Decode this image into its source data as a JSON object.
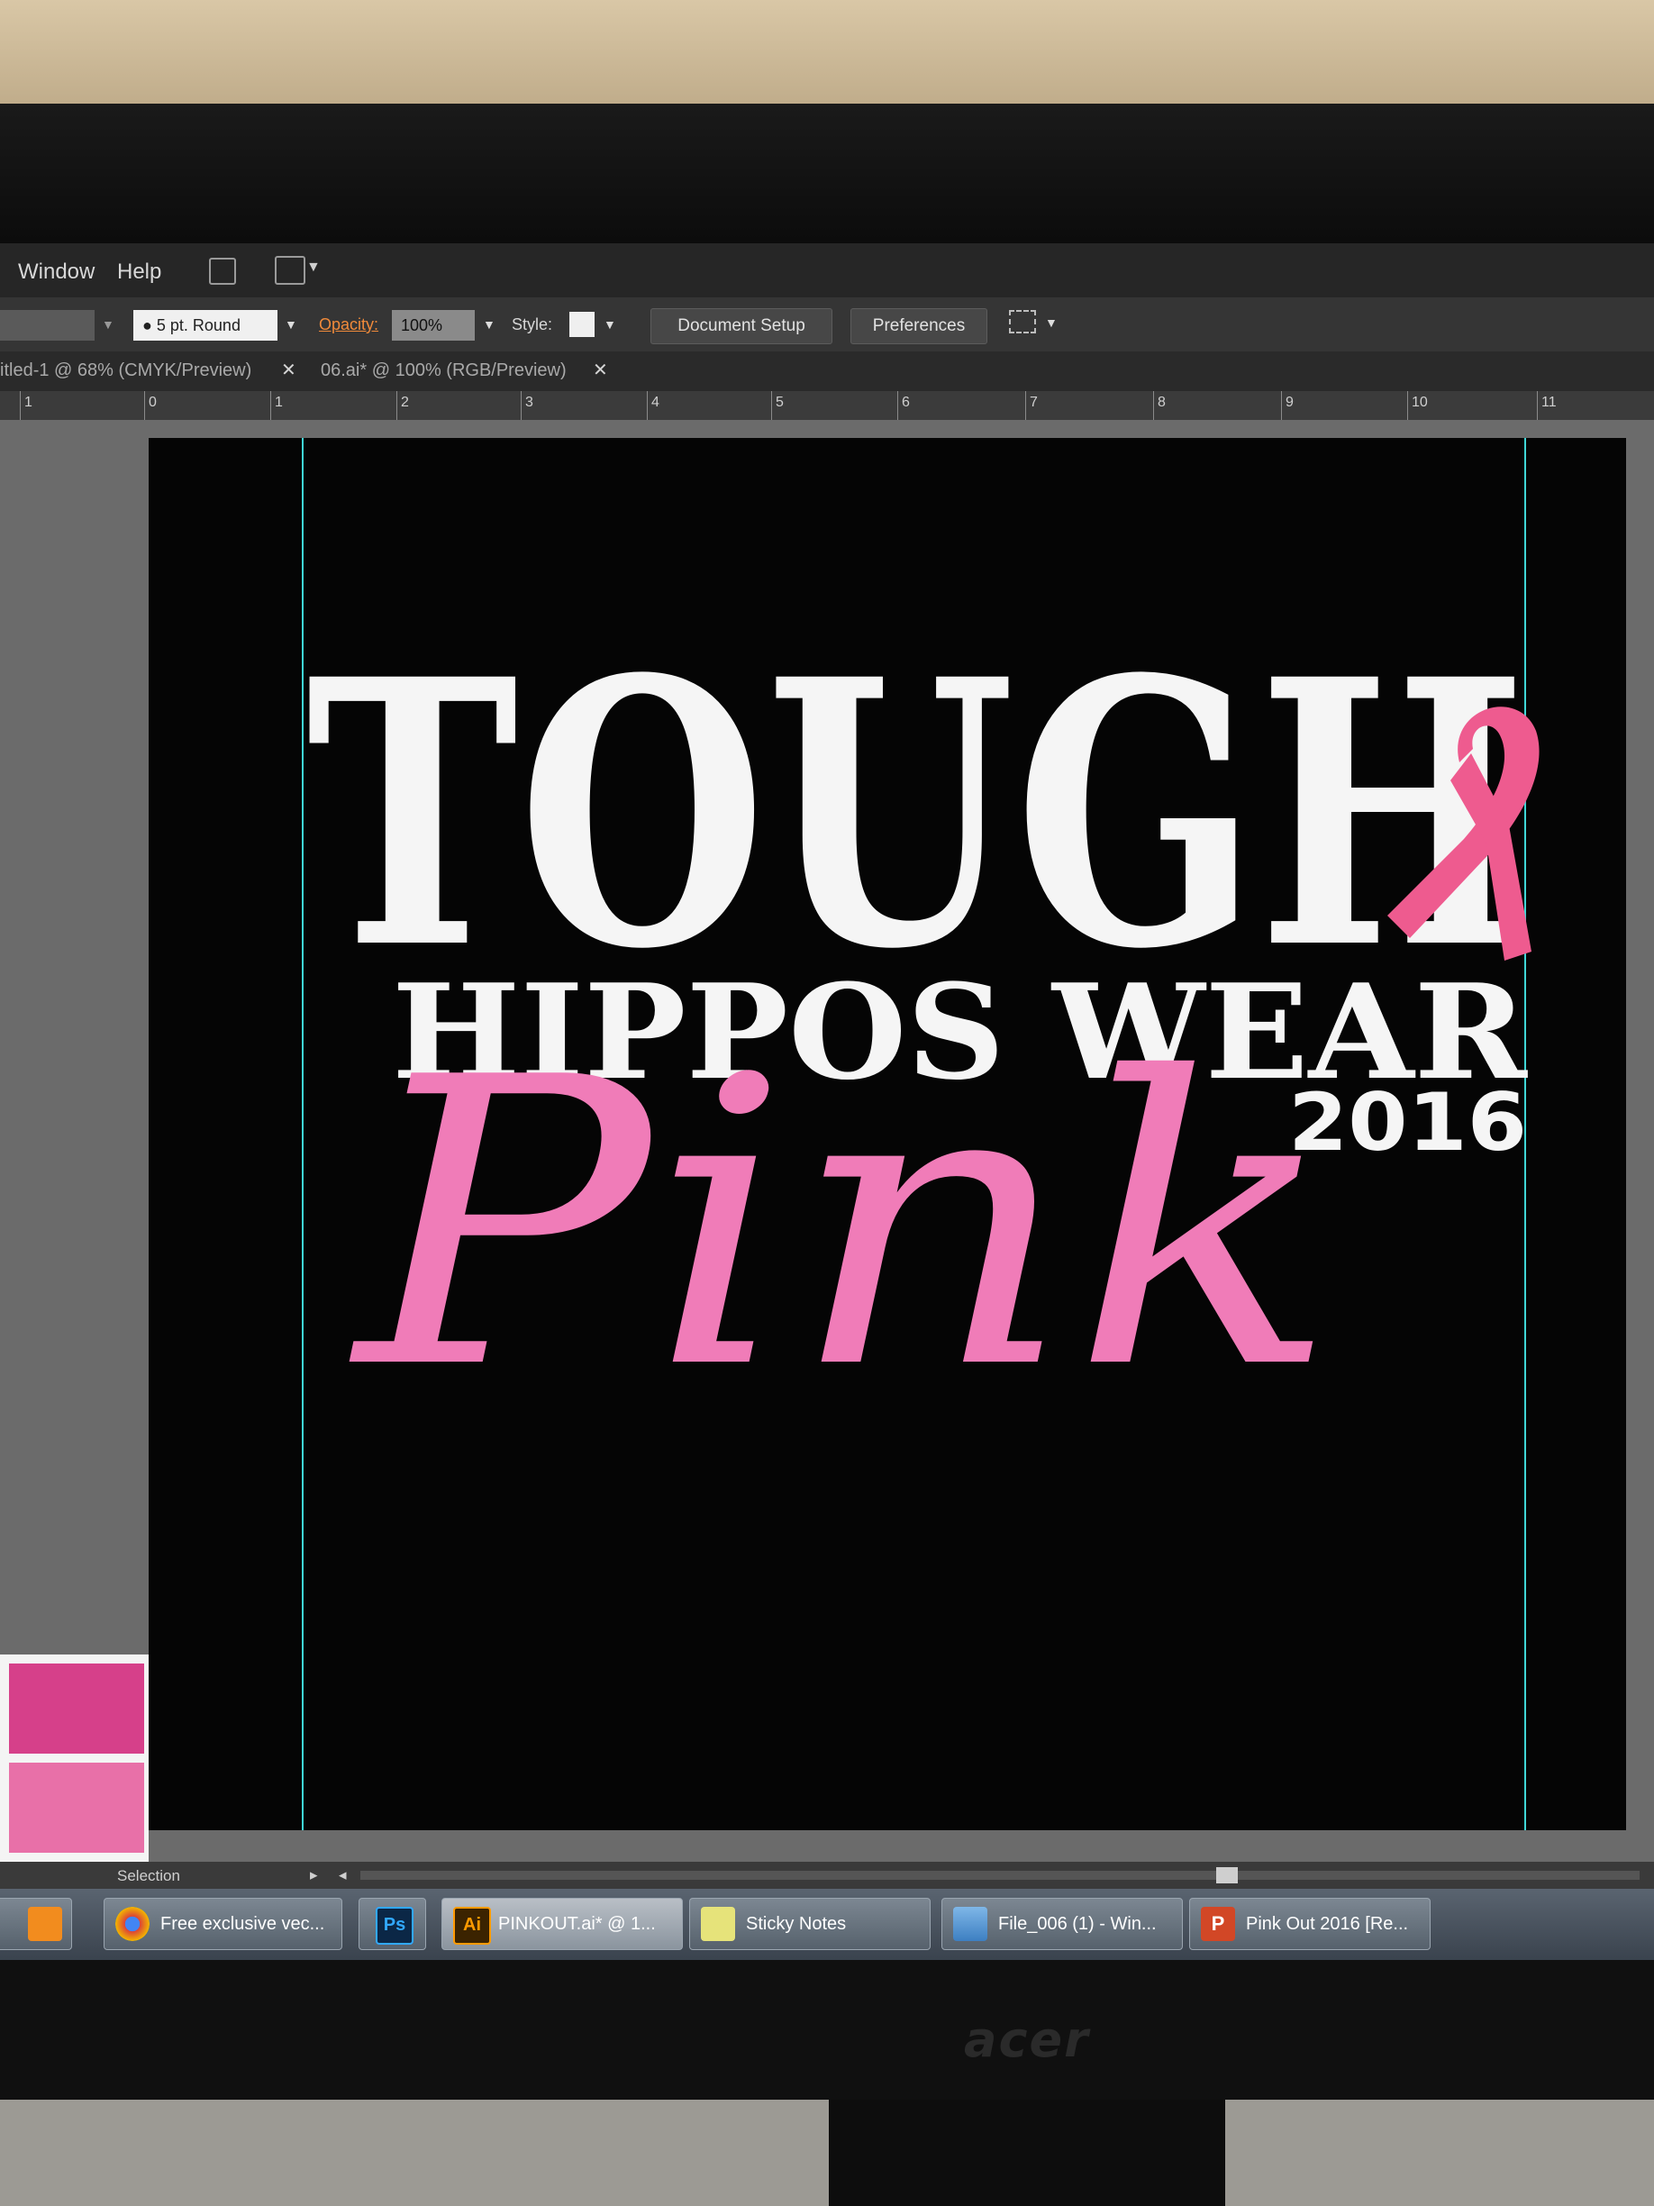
{
  "menu": {
    "window": "Window",
    "help": "Help"
  },
  "control_bar": {
    "stroke": "5 pt. Round",
    "opacity_label": "Opacity:",
    "opacity_value": "100%",
    "style_label": "Style:",
    "document_setup": "Document Setup",
    "preferences": "Preferences"
  },
  "tabs": [
    {
      "label": "itled-1 @ 68% (CMYK/Preview)"
    },
    {
      "label": "06.ai* @ 100% (RGB/Preview)"
    }
  ],
  "ruler": [
    "1",
    "0",
    "1",
    "2",
    "3",
    "4",
    "5",
    "6",
    "7",
    "8",
    "9",
    "10",
    "11"
  ],
  "artwork": {
    "line1": "TOUGH",
    "line2": "HIPPOS WEAR",
    "year": "2016",
    "script": "Pink",
    "colors": {
      "background": "#050505",
      "white": "#f5f5f5",
      "pink": "#f07cb8",
      "ribbon": "#ee5b8f"
    }
  },
  "swatches": [
    "#d6408a",
    "#e870a8",
    "#f2c6d6"
  ],
  "status": {
    "tool": "Selection"
  },
  "taskbar": [
    {
      "label": "Free exclusive vec...",
      "icon": "chrome-icon"
    },
    {
      "label": "",
      "icon": "photoshop-icon"
    },
    {
      "label": "PINKOUT.ai* @ 1...",
      "icon": "illustrator-icon"
    },
    {
      "label": "Sticky Notes",
      "icon": "sticky-notes-icon"
    },
    {
      "label": "File_006 (1) - Win...",
      "icon": "photo-viewer-icon"
    },
    {
      "label": "Pink Out 2016 [Re...",
      "icon": "powerpoint-icon"
    }
  ],
  "monitor_brand": "acer"
}
